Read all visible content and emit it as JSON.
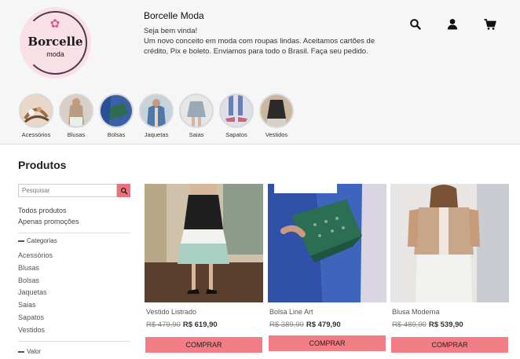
{
  "store": {
    "logo_name": "Borcelle",
    "logo_sub": "moda",
    "name": "Borcelle Moda",
    "description_lines": [
      "Seja bem vinda!",
      "Um novo conceito em moda com roupas lindas. Aceitamos cartões de",
      "crédito, Pix e boleto. Enviamos para todo o Brasil. Faça seu pedido."
    ]
  },
  "header_icons": [
    "search-icon",
    "user-icon",
    "cart-icon"
  ],
  "categories_bar": [
    {
      "label": "Acessórios"
    },
    {
      "label": "Blusas"
    },
    {
      "label": "Bolsas"
    },
    {
      "label": "Jaquetas"
    },
    {
      "label": "Saias"
    },
    {
      "label": "Sapatos"
    },
    {
      "label": "Vestidos"
    }
  ],
  "products_section": {
    "title": "Produtos",
    "search_placeholder": "Pesquisar",
    "links": [
      "Todos produtos",
      "Apenas promoções"
    ],
    "categories_heading": "Categorias",
    "categories": [
      "Acessórios",
      "Blusas",
      "Bolsas",
      "Jaquetas",
      "Saias",
      "Sapatos",
      "Vestidos"
    ],
    "value_heading": "Valor"
  },
  "products": [
    {
      "name": "Vestido Listrado",
      "old_price": "R$ 479,90",
      "price": "R$ 619,90",
      "button": "COMPRAR"
    },
    {
      "name": "Bolsa Line Art",
      "old_price": "R$ 389,90",
      "price": "R$ 479,90",
      "button": "COMPRAR"
    },
    {
      "name": "Blusa Moderna",
      "old_price": "R$ 489,90",
      "price": "R$ 539,90",
      "button": "COMPRAR"
    }
  ],
  "colors": {
    "header_bg": "#f6f6f6",
    "accent": "#f17d85",
    "search_button": "#f0707a"
  }
}
